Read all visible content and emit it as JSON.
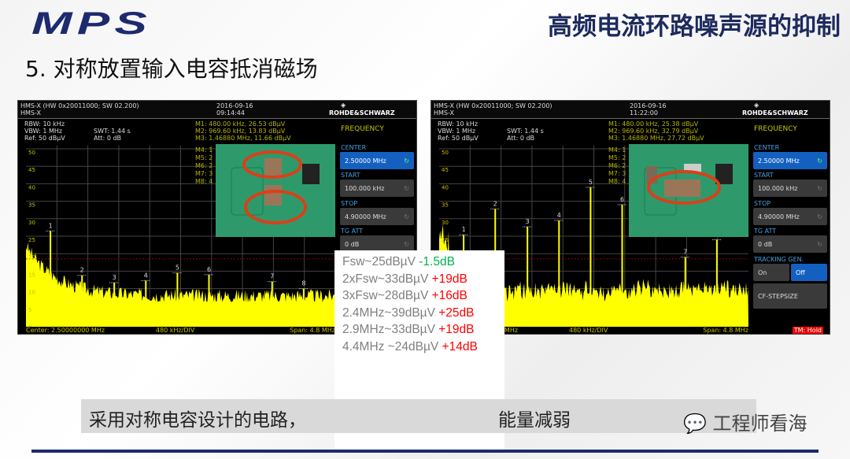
{
  "header": {
    "logo": "MPS",
    "title": "高频电流环路噪声源的抑制"
  },
  "subtitle": "5. 对称放置输入电容抵消磁场",
  "colors": {
    "brand": "#1d2a6e",
    "trace": "#ffff00",
    "marker_text": "#b8b400",
    "increase": "#ff0000",
    "decrease": "#00b050",
    "panel_selected": "#1460c0"
  },
  "screens": [
    {
      "device": "HMS-X (HW 0x20011000; SW 02.200)",
      "model": "HMS-X",
      "date": "2016-09-16",
      "time": "09:14:44",
      "brand": "ROHDE&SCHWARZ",
      "rbw": "RBW: 10 kHz",
      "vbw": "VBW: 1 MHz",
      "ref": "Ref: 50 dBµV",
      "swt": "SWT: 1.44 s",
      "att": "Att: 0 dB",
      "m1": "M1: 480.00 kHz, 26.53 dBµV",
      "m2": "M2: 969.60 kHz, 13.83 dBµV",
      "m3": "M3: 1.46880 MHz, 11.66 dBµV",
      "mlabels": [
        "M4: 1",
        "M5: 2",
        "M6: 2",
        "M7: 3",
        "M8: 4"
      ],
      "center": "Center: 2.50000000 MHz",
      "div": "480 kHz/DIV",
      "span": "Span: 4.8 MHz",
      "tm": "",
      "menu": {
        "title": "FREQUENCY",
        "center_label": "CENTER",
        "center": "2.50000 MHz",
        "start_label": "START",
        "start": "100.000 kHz",
        "stop_label": "STOP",
        "stop": "4.90000 MHz",
        "tg_label": "TG ATT",
        "tg": "0 dB"
      },
      "floor_start": 30,
      "markers": [
        {
          "f": 0.48,
          "db": 26.5
        },
        {
          "f": 0.97,
          "db": 13.8
        },
        {
          "f": 1.47,
          "db": 11.7
        },
        {
          "f": 1.96,
          "db": 12.3
        },
        {
          "f": 2.45,
          "db": 14.5
        },
        {
          "f": 2.94,
          "db": 14
        },
        {
          "f": 3.92,
          "db": 12
        },
        {
          "f": 4.41,
          "db": 10
        }
      ]
    },
    {
      "device": "HMS-X (HW 0x20011000; SW 02.200)",
      "model": "HMS-X",
      "date": "2016-09-16",
      "time": "11:22:00",
      "brand": "ROHDE&SCHWARZ",
      "rbw": "RBW: 10 kHz",
      "vbw": "VBW: 1 MHz",
      "ref": "Ref: 50 dBµV",
      "swt": "SWT: 1.44 s",
      "att": "Att: 0 dB",
      "m1": "M1: 480.00 kHz, 25.38 dBµV",
      "m2": "M2: 969.60 kHz, 32.79 dBµV",
      "m3": "M3: 1.46880 MHz, 27.72 dBµV",
      "mlabels": [
        "M4: 1",
        "M5: 2",
        "M6: 2",
        "M7: 3",
        "M8: 4"
      ],
      "center": "Center: 2.50000000 MHz",
      "div": "480 kHz/DIV",
      "span": "Span: 4.8 MHz",
      "tm": "TM: Hold",
      "menu": {
        "title": "FREQUENCY",
        "center_label": "CENTER",
        "center": "2.50000 MHz",
        "start_label": "START",
        "start": "100.000 kHz",
        "stop_label": "STOP",
        "stop": "4.90000 MHz",
        "tg_label": "TG ATT",
        "tg": "0 dB",
        "tracking_label": "TRACKING GEN.",
        "on": "On",
        "off": "Off",
        "stepsize": "CF-STEPSIZE"
      },
      "floor_start": 30,
      "markers": [
        {
          "f": 0.48,
          "db": 25.4
        },
        {
          "f": 0.97,
          "db": 32.8
        },
        {
          "f": 1.47,
          "db": 27.7
        },
        {
          "f": 1.96,
          "db": 29.5
        },
        {
          "f": 2.45,
          "db": 39
        },
        {
          "f": 2.94,
          "db": 34
        },
        {
          "f": 3.92,
          "db": 19
        },
        {
          "f": 4.41,
          "db": 24
        }
      ]
    }
  ],
  "yticks": [
    "50",
    "45",
    "40",
    "35",
    "30",
    "25",
    "20",
    "15",
    "10",
    "5",
    "0"
  ],
  "notes": [
    {
      "text": "Fsw~25dBµV ",
      "delta": "-1.5dB",
      "color": "#00b050"
    },
    {
      "text": "2xFsw~33dBµV ",
      "delta": "+19dB",
      "color": "#ff0000"
    },
    {
      "text": "3xFsw~28dBµV ",
      "delta": "+16dB",
      "color": "#ff0000"
    },
    {
      "text": "2.4MHz~39dBµV ",
      "delta": "+25dB",
      "color": "#ff0000"
    },
    {
      "text": "2.9MHz~33dBµV ",
      "delta": "+19dB",
      "color": "#ff0000"
    },
    {
      "text": "4.4MHz ~24dBµV ",
      "delta": "+14dB",
      "color": "#ff0000"
    }
  ],
  "banner": {
    "left": "采用对称电容设计的电路，",
    "right": "能量减弱"
  },
  "watermark": "工程师看海"
}
